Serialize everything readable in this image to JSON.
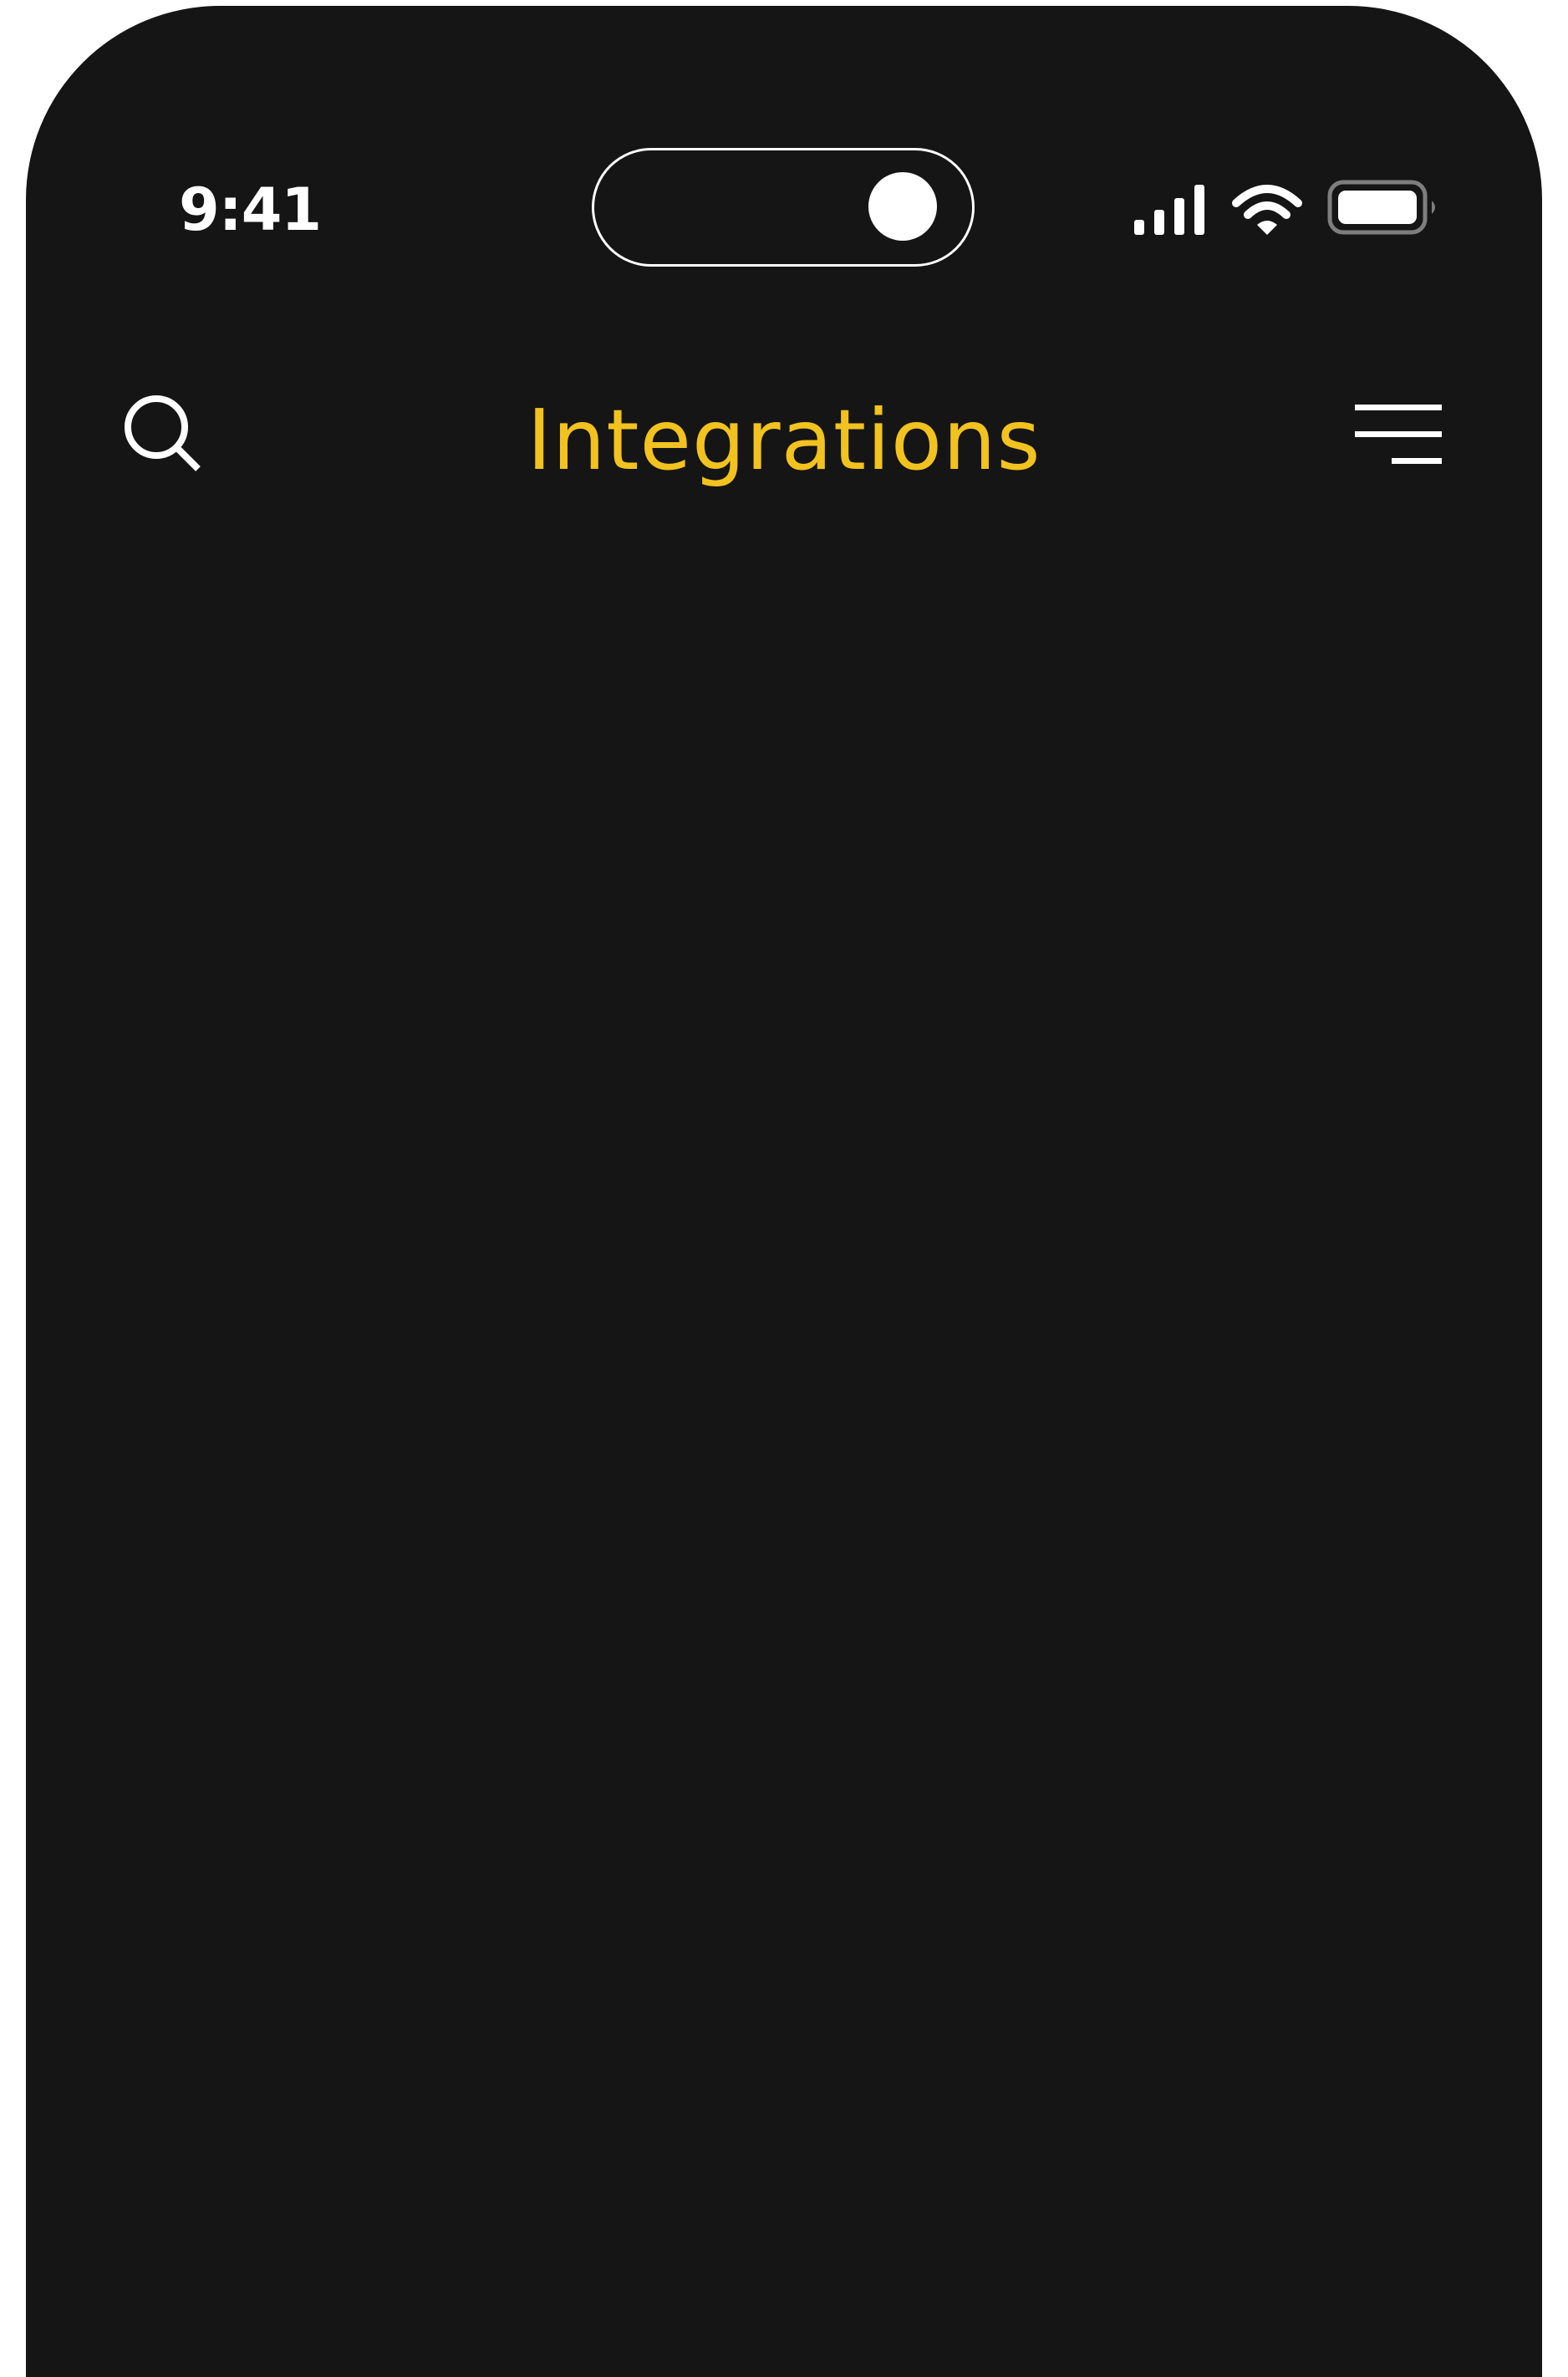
{
  "status_bar": {
    "time": "9:41",
    "signal_icon": "cellular-signal-icon",
    "wifi_icon": "wifi-icon",
    "battery_icon": "battery-icon"
  },
  "header": {
    "title": "Integrations",
    "search_icon": "search-icon",
    "menu_icon": "menu-icon"
  },
  "colors": {
    "background": "#151515",
    "accent": "#f2c21f",
    "foreground": "#ffffff"
  }
}
